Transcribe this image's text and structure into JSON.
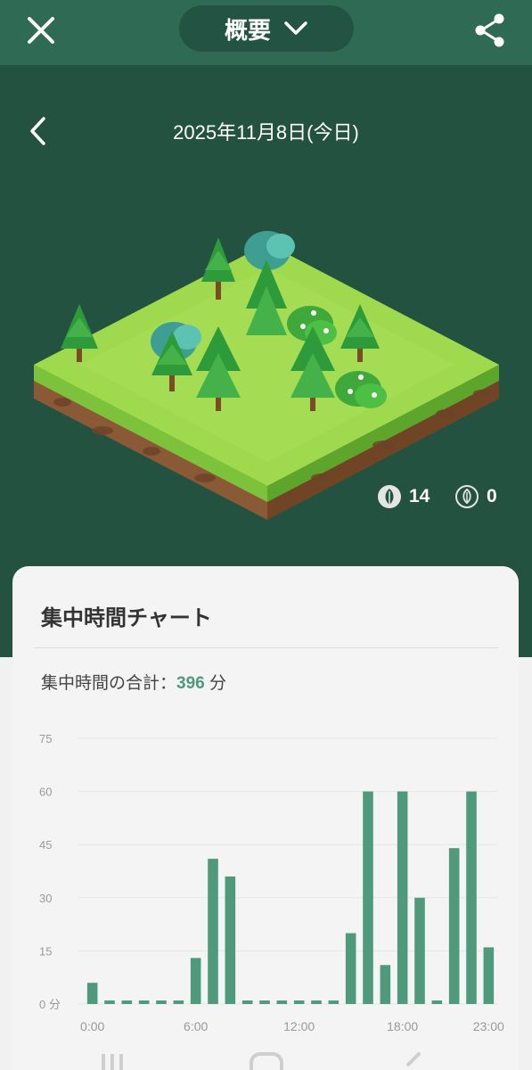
{
  "header": {
    "title": "概要",
    "close_icon": "close-icon",
    "share_icon": "share-icon",
    "dropdown_icon": "chevron-down-icon"
  },
  "hero": {
    "date": "2025年11月8日(今日)",
    "back_icon": "chevron-left-icon",
    "trees_count": "14",
    "dead_trees_count": "0"
  },
  "chart_card": {
    "title": "集中時間チャート",
    "total_label": "集中時間の合計：",
    "total_value": "396",
    "total_unit": "分"
  },
  "chart_data": {
    "type": "bar",
    "ylim": [
      0,
      75
    ],
    "y_ticks": [
      "0 分",
      "15",
      "30",
      "45",
      "60",
      "75"
    ],
    "x_tick_labels": [
      "0:00",
      "6:00",
      "12:00",
      "18:00",
      "23:00"
    ],
    "categories": [
      "0:00",
      "1:00",
      "2:00",
      "3:00",
      "4:00",
      "5:00",
      "6:00",
      "7:00",
      "8:00",
      "9:00",
      "10:00",
      "11:00",
      "12:00",
      "13:00",
      "14:00",
      "15:00",
      "16:00",
      "17:00",
      "18:00",
      "19:00",
      "20:00",
      "21:00",
      "22:00",
      "23:00"
    ],
    "values": [
      6,
      1,
      1,
      1,
      1,
      1,
      13,
      41,
      36,
      1,
      1,
      1,
      1,
      1,
      1,
      20,
      60,
      11,
      60,
      30,
      1,
      44,
      60,
      16
    ],
    "bar_color": "#4f9a7d",
    "grid": true
  },
  "colors": {
    "topbar": "#2f6b54",
    "hero_bg": "#245240",
    "accent": "#4f9a7d"
  }
}
